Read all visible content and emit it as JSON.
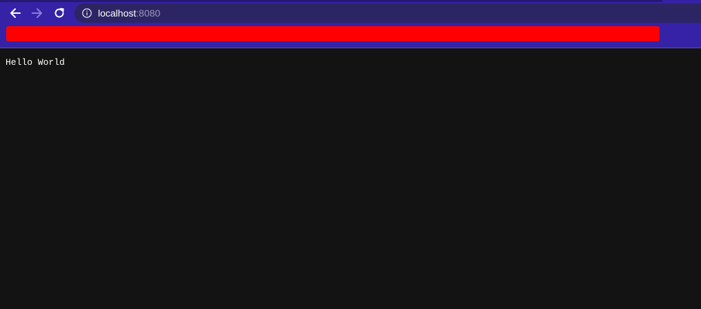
{
  "address_bar": {
    "host": "localhost",
    "port": ":8080"
  },
  "icons": {
    "back": "back-arrow-icon",
    "forward": "forward-arrow-icon",
    "reload": "reload-icon",
    "site_info": "info-icon"
  },
  "colors": {
    "chrome": "#3522a6",
    "omnibox": "#2c2563",
    "banner": "#ff0000",
    "page_background": "#131313",
    "page_text": "#ffffff"
  },
  "page": {
    "text": "Hello World"
  }
}
